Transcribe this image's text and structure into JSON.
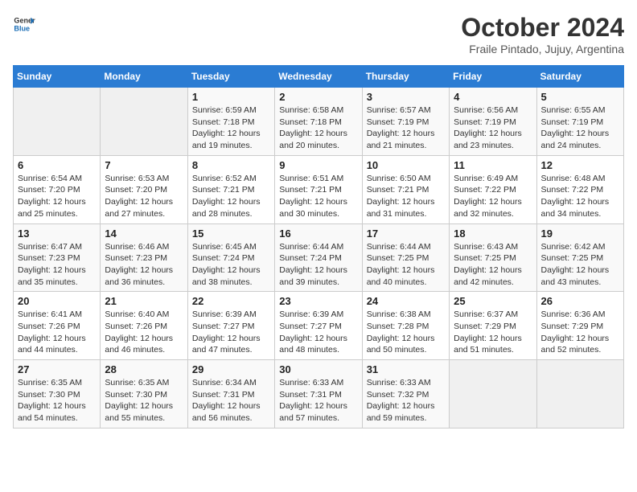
{
  "logo": {
    "line1": "General",
    "line2": "Blue"
  },
  "title": "October 2024",
  "subtitle": "Fraile Pintado, Jujuy, Argentina",
  "weekdays": [
    "Sunday",
    "Monday",
    "Tuesday",
    "Wednesday",
    "Thursday",
    "Friday",
    "Saturday"
  ],
  "weeks": [
    [
      {
        "day": "",
        "info": ""
      },
      {
        "day": "",
        "info": ""
      },
      {
        "day": "1",
        "info": "Sunrise: 6:59 AM\nSunset: 7:18 PM\nDaylight: 12 hours and 19 minutes."
      },
      {
        "day": "2",
        "info": "Sunrise: 6:58 AM\nSunset: 7:18 PM\nDaylight: 12 hours and 20 minutes."
      },
      {
        "day": "3",
        "info": "Sunrise: 6:57 AM\nSunset: 7:19 PM\nDaylight: 12 hours and 21 minutes."
      },
      {
        "day": "4",
        "info": "Sunrise: 6:56 AM\nSunset: 7:19 PM\nDaylight: 12 hours and 23 minutes."
      },
      {
        "day": "5",
        "info": "Sunrise: 6:55 AM\nSunset: 7:19 PM\nDaylight: 12 hours and 24 minutes."
      }
    ],
    [
      {
        "day": "6",
        "info": "Sunrise: 6:54 AM\nSunset: 7:20 PM\nDaylight: 12 hours and 25 minutes."
      },
      {
        "day": "7",
        "info": "Sunrise: 6:53 AM\nSunset: 7:20 PM\nDaylight: 12 hours and 27 minutes."
      },
      {
        "day": "8",
        "info": "Sunrise: 6:52 AM\nSunset: 7:21 PM\nDaylight: 12 hours and 28 minutes."
      },
      {
        "day": "9",
        "info": "Sunrise: 6:51 AM\nSunset: 7:21 PM\nDaylight: 12 hours and 30 minutes."
      },
      {
        "day": "10",
        "info": "Sunrise: 6:50 AM\nSunset: 7:21 PM\nDaylight: 12 hours and 31 minutes."
      },
      {
        "day": "11",
        "info": "Sunrise: 6:49 AM\nSunset: 7:22 PM\nDaylight: 12 hours and 32 minutes."
      },
      {
        "day": "12",
        "info": "Sunrise: 6:48 AM\nSunset: 7:22 PM\nDaylight: 12 hours and 34 minutes."
      }
    ],
    [
      {
        "day": "13",
        "info": "Sunrise: 6:47 AM\nSunset: 7:23 PM\nDaylight: 12 hours and 35 minutes."
      },
      {
        "day": "14",
        "info": "Sunrise: 6:46 AM\nSunset: 7:23 PM\nDaylight: 12 hours and 36 minutes."
      },
      {
        "day": "15",
        "info": "Sunrise: 6:45 AM\nSunset: 7:24 PM\nDaylight: 12 hours and 38 minutes."
      },
      {
        "day": "16",
        "info": "Sunrise: 6:44 AM\nSunset: 7:24 PM\nDaylight: 12 hours and 39 minutes."
      },
      {
        "day": "17",
        "info": "Sunrise: 6:44 AM\nSunset: 7:25 PM\nDaylight: 12 hours and 40 minutes."
      },
      {
        "day": "18",
        "info": "Sunrise: 6:43 AM\nSunset: 7:25 PM\nDaylight: 12 hours and 42 minutes."
      },
      {
        "day": "19",
        "info": "Sunrise: 6:42 AM\nSunset: 7:25 PM\nDaylight: 12 hours and 43 minutes."
      }
    ],
    [
      {
        "day": "20",
        "info": "Sunrise: 6:41 AM\nSunset: 7:26 PM\nDaylight: 12 hours and 44 minutes."
      },
      {
        "day": "21",
        "info": "Sunrise: 6:40 AM\nSunset: 7:26 PM\nDaylight: 12 hours and 46 minutes."
      },
      {
        "day": "22",
        "info": "Sunrise: 6:39 AM\nSunset: 7:27 PM\nDaylight: 12 hours and 47 minutes."
      },
      {
        "day": "23",
        "info": "Sunrise: 6:39 AM\nSunset: 7:27 PM\nDaylight: 12 hours and 48 minutes."
      },
      {
        "day": "24",
        "info": "Sunrise: 6:38 AM\nSunset: 7:28 PM\nDaylight: 12 hours and 50 minutes."
      },
      {
        "day": "25",
        "info": "Sunrise: 6:37 AM\nSunset: 7:29 PM\nDaylight: 12 hours and 51 minutes."
      },
      {
        "day": "26",
        "info": "Sunrise: 6:36 AM\nSunset: 7:29 PM\nDaylight: 12 hours and 52 minutes."
      }
    ],
    [
      {
        "day": "27",
        "info": "Sunrise: 6:35 AM\nSunset: 7:30 PM\nDaylight: 12 hours and 54 minutes."
      },
      {
        "day": "28",
        "info": "Sunrise: 6:35 AM\nSunset: 7:30 PM\nDaylight: 12 hours and 55 minutes."
      },
      {
        "day": "29",
        "info": "Sunrise: 6:34 AM\nSunset: 7:31 PM\nDaylight: 12 hours and 56 minutes."
      },
      {
        "day": "30",
        "info": "Sunrise: 6:33 AM\nSunset: 7:31 PM\nDaylight: 12 hours and 57 minutes."
      },
      {
        "day": "31",
        "info": "Sunrise: 6:33 AM\nSunset: 7:32 PM\nDaylight: 12 hours and 59 minutes."
      },
      {
        "day": "",
        "info": ""
      },
      {
        "day": "",
        "info": ""
      }
    ]
  ]
}
